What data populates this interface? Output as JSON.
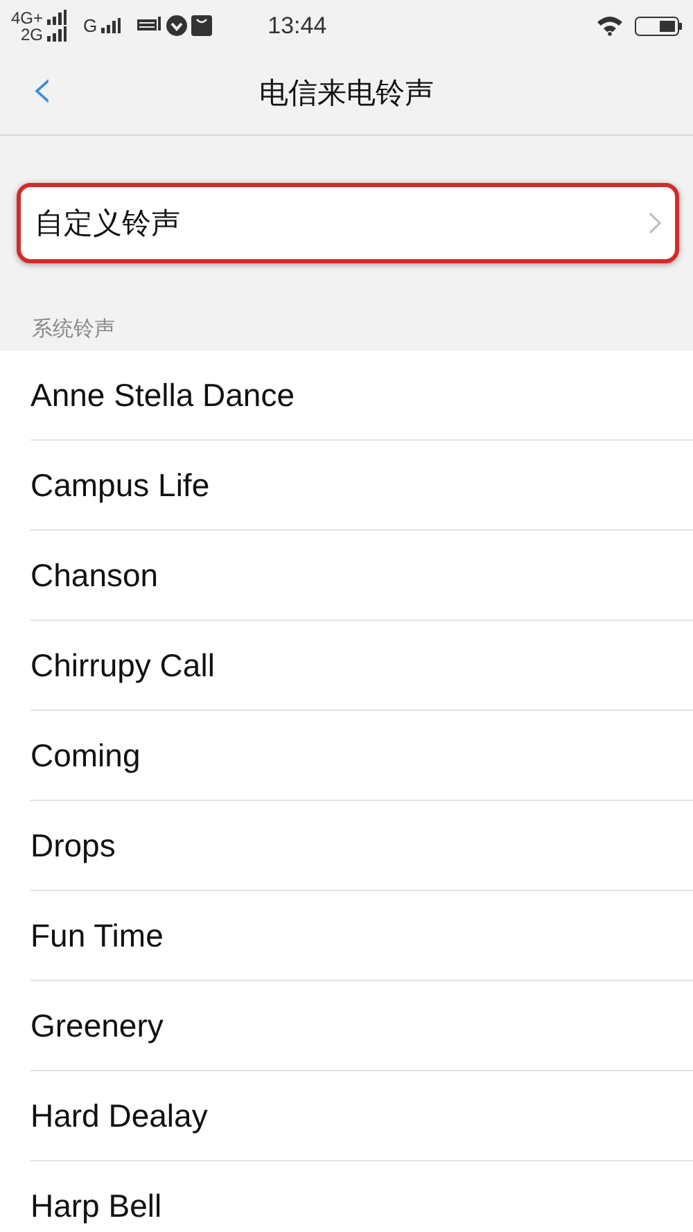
{
  "status_bar": {
    "network_1": "4G+",
    "network_2": "2G",
    "network_3": "G",
    "time": "13:44"
  },
  "nav_bar": {
    "back_icon": "‹",
    "title": "电信来电铃声"
  },
  "custom_ringtone": {
    "label": "自定义铃声",
    "highlighted": true
  },
  "section_label": "系统铃声",
  "ringtones": [
    {
      "name": "Anne Stella Dance"
    },
    {
      "name": "Campus Life"
    },
    {
      "name": "Chanson"
    },
    {
      "name": "Chirrupy Call"
    },
    {
      "name": "Coming"
    },
    {
      "name": "Drops"
    },
    {
      "name": "Fun Time"
    },
    {
      "name": "Greenery"
    },
    {
      "name": "Hard Dealay"
    },
    {
      "name": "Harp Bell"
    }
  ]
}
